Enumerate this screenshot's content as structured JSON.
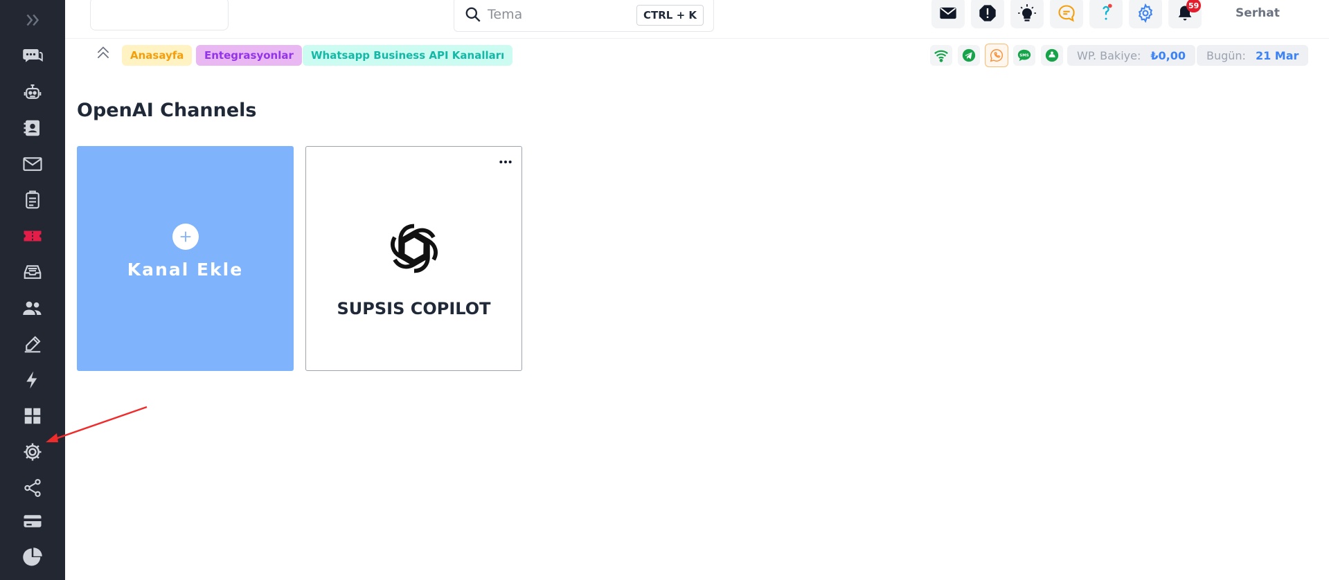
{
  "search": {
    "placeholder": "Tema",
    "shortcut": "CTRL + K"
  },
  "header": {
    "user_name": "Serhat",
    "notification_count": "59"
  },
  "breadcrumbs": [
    {
      "label": "Anasayfa",
      "bg": "#fff3c4",
      "color": "#f59e0b"
    },
    {
      "label": "Entegrasyonlar",
      "bg": "#e9b8f3",
      "color": "#9333ea"
    },
    {
      "label": "Whatsapp Business API Kanalları",
      "bg": "#ccfbf1",
      "color": "#14b8a6"
    }
  ],
  "status": {
    "balance_label": "WP. Bakiye:",
    "balance_value": "₺0,00",
    "date_label": "Bugün:",
    "date_value": "21 Mar",
    "sms_label": "SMS"
  },
  "page": {
    "title": "OpenAI Channels"
  },
  "cards": {
    "add_label": "Kanal Ekle",
    "channel_name": "SUPSIS COPILOT"
  },
  "colors": {
    "sidebar_bg": "#232732",
    "add_card_bg": "#7fb3fb",
    "accent_blue": "#3b82f6",
    "ticket_active": "#e11d48",
    "whatsapp_green": "#16a34a"
  }
}
